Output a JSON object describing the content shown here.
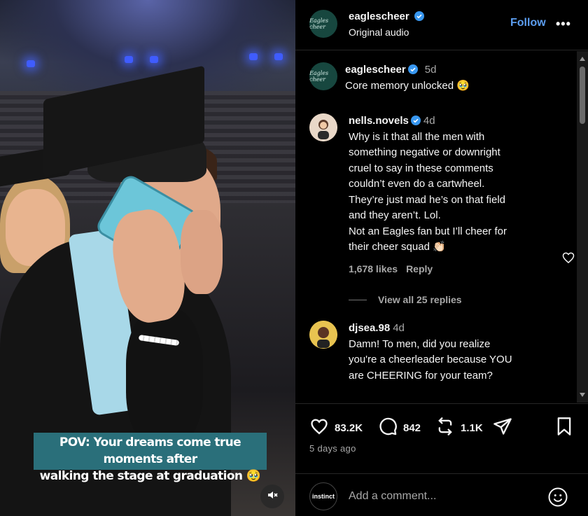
{
  "video": {
    "caption_line1": "POV: Your dreams come true moments after",
    "caption_line2": "walking the stage at graduation 🥹",
    "mute_icon": "speaker-muted-icon"
  },
  "header": {
    "username": "eaglescheer",
    "subtitle": "Original audio",
    "follow_label": "Follow",
    "more_label": "•••",
    "avatar_text": "Eagles cheer"
  },
  "comments": [
    {
      "username": "eaglescheer",
      "time": "5d",
      "text": "Core memory unlocked 🥹",
      "verified": true
    },
    {
      "username": "nells.novels",
      "time": "4d",
      "lines": [
        "Why is it that all the men with",
        "something negative or downright",
        "cruel to say in these comments",
        "couldn’t even do a cartwheel.",
        "They’re just mad he’s on that field",
        "and they aren’t. Lol.",
        "Not an Eagles fan but I’ll cheer for",
        "their cheer squad 👏🏻"
      ],
      "likes": "1,678 likes",
      "reply_label": "Reply",
      "view_replies": "View all 25 replies",
      "verified": true
    },
    {
      "username": "djsea.98",
      "time": "4d",
      "lines": [
        "Damn! To men, did you realize",
        "you're a cheerleader because YOU",
        "are CHEERING for your team?"
      ],
      "verified": false
    }
  ],
  "actions": {
    "likes": "83.2K",
    "comments": "842",
    "reposts": "1.1K",
    "posted": "5 days ago"
  },
  "add_comment": {
    "placeholder": "Add a comment...",
    "my_avatar_text": "instinct"
  },
  "colors": {
    "accent": "#5c9ef0",
    "verified": "#3897f0",
    "caption_bg": "#2a6f7a",
    "avatar_bg": "#17473f"
  }
}
